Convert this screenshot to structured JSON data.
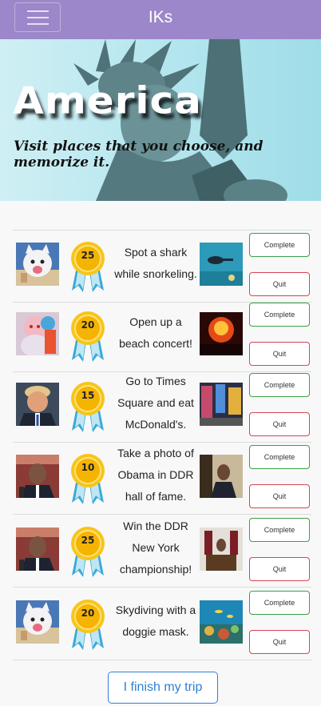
{
  "navbar": {
    "brand": "IKs",
    "menu_icon": "hamburger-icon",
    "color": "#9b87c9"
  },
  "hero": {
    "title": "America",
    "subtitle": "Visit places that you choose, and memorize it."
  },
  "challenges": [
    {
      "avatar": "dog-mask-avatar",
      "points": "25",
      "text": "Spot a shark while snorkeling.",
      "place": "snorkeling-photo",
      "complete_label": "Complete",
      "quit_label": "Quit"
    },
    {
      "avatar": "girl-avatar",
      "points": "20",
      "text": "Open up a beach concert!",
      "place": "concert-photo",
      "complete_label": "Complete",
      "quit_label": "Quit"
    },
    {
      "avatar": "trump-avatar",
      "points": "15",
      "text": "Go to Times Square and eat McDonald's.",
      "place": "times-square-photo",
      "complete_label": "Complete",
      "quit_label": "Quit"
    },
    {
      "avatar": "obama-avatar",
      "points": "10",
      "text": "Take a photo of Obama in DDR hall of fame.",
      "place": "obama-office-photo",
      "complete_label": "Complete",
      "quit_label": "Quit"
    },
    {
      "avatar": "obama-avatar",
      "points": "25",
      "text": "Win the DDR New York championship!",
      "place": "oval-office-photo",
      "complete_label": "Complete",
      "quit_label": "Quit"
    },
    {
      "avatar": "dog-mask-avatar",
      "points": "20",
      "text": "Skydiving with a doggie mask.",
      "place": "reef-photo",
      "complete_label": "Complete",
      "quit_label": "Quit"
    }
  ],
  "finish_button": "I finish my trip",
  "colors": {
    "complete": "#3aa047",
    "quit": "#d94355",
    "finish": "#2f7fd6"
  }
}
